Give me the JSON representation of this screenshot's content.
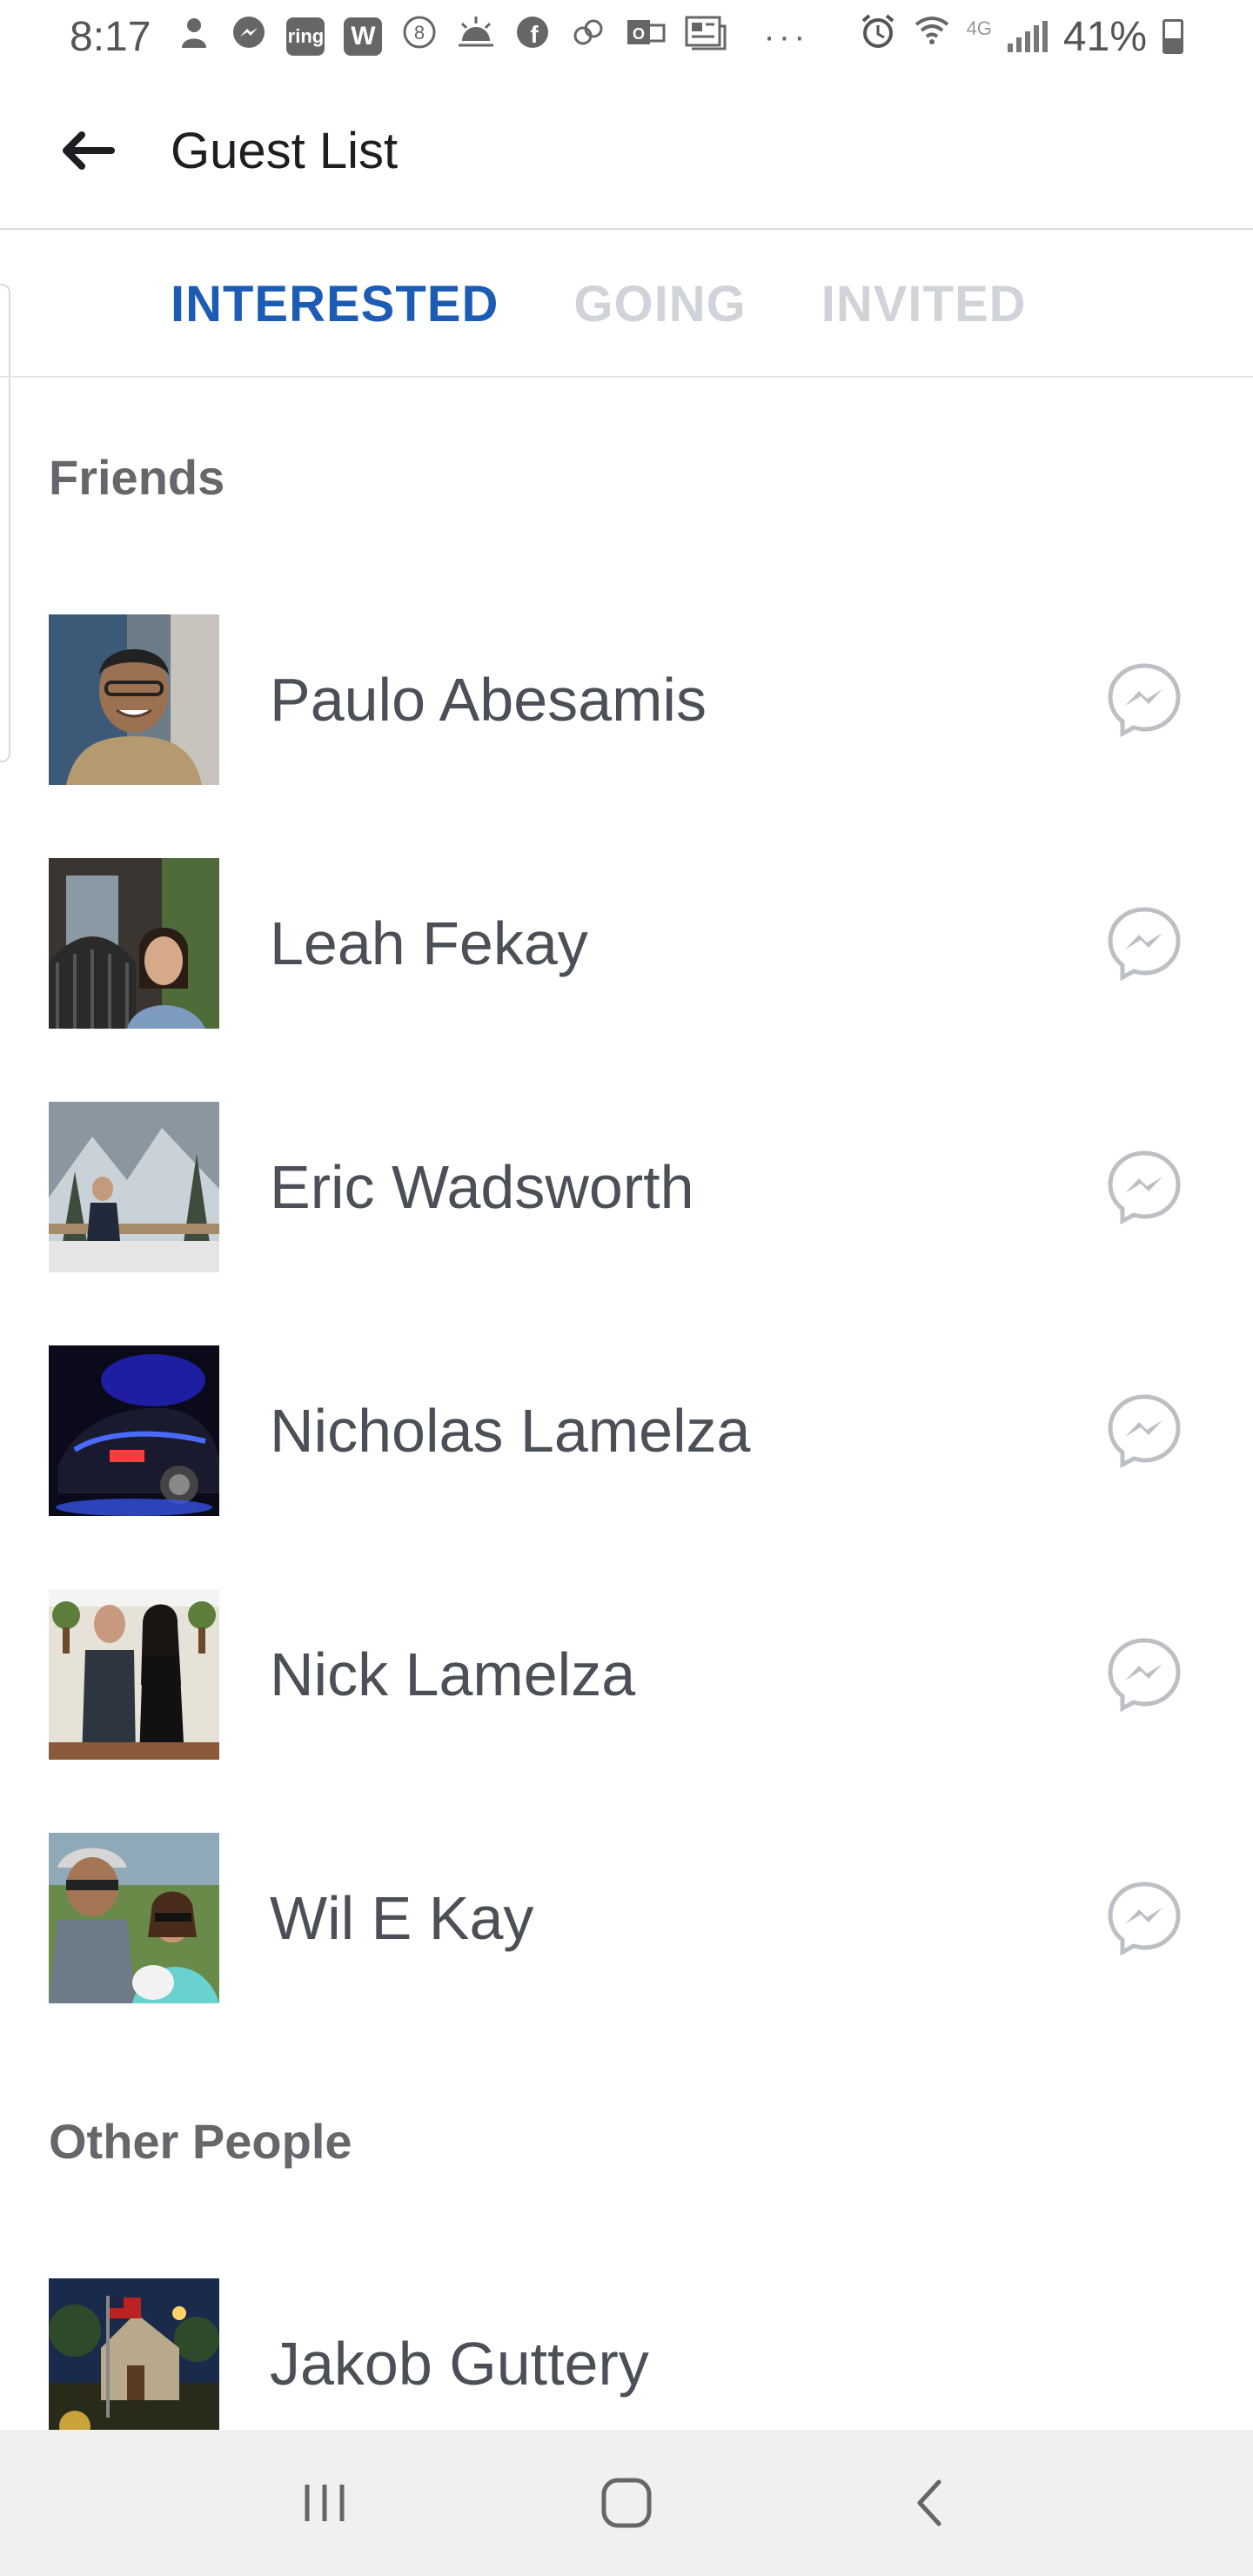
{
  "status_bar": {
    "time": "8:17",
    "battery_percent": "41%",
    "network": "4G",
    "icons": [
      "profile-icon",
      "messenger-icon",
      "ring-icon",
      "w-app-icon",
      "eight-icon",
      "weather-icon",
      "facebook-icon",
      "link-icon",
      "outlook-icon",
      "news-icon",
      "more-dots-icon",
      "alarm-icon",
      "wifi-icon",
      "signal-icon",
      "battery-icon"
    ]
  },
  "header": {
    "title": "Guest List",
    "back_icon": "arrow-left-icon"
  },
  "tabs": [
    {
      "label": "INTERESTED",
      "active": true
    },
    {
      "label": "GOING",
      "active": false
    },
    {
      "label": "INVITED",
      "active": false
    }
  ],
  "sections": {
    "friends": {
      "title": "Friends",
      "guests": [
        {
          "name": "Paulo Abesamis"
        },
        {
          "name": "Leah Fekay"
        },
        {
          "name": "Eric Wadsworth"
        },
        {
          "name": "Nicholas Lamelza"
        },
        {
          "name": "Nick Lamelza"
        },
        {
          "name": "Wil E Kay"
        }
      ]
    },
    "other": {
      "title": "Other People",
      "guests": [
        {
          "name": "Jakob Guttery"
        }
      ]
    }
  },
  "nav_bar": {
    "icons": [
      "recent-apps-icon",
      "home-icon",
      "back-icon"
    ]
  },
  "colors": {
    "accent": "#1d5cb5",
    "inactive_tab": "#d0d3d8",
    "text": "#4b4f56",
    "section_header": "#65676b",
    "nav_bg": "#f0f0f0"
  }
}
